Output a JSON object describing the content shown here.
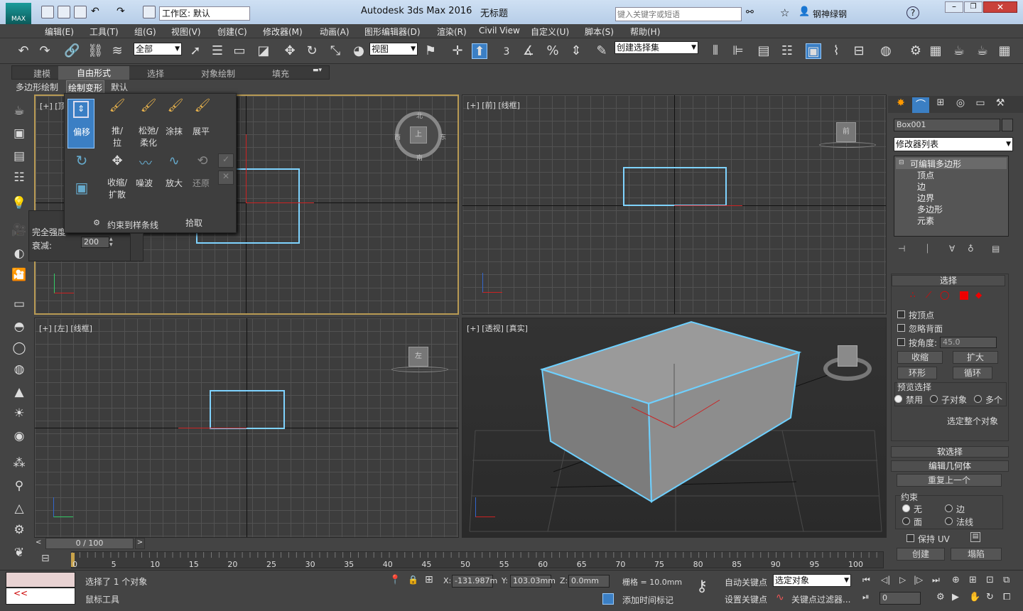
{
  "titlebar": {
    "app_title": "Autodesk 3ds Max 2016",
    "doc_title": "无标题",
    "workspace": "工作区: 默认",
    "search_placeholder": "键入关键字或短语",
    "user": "钢神绿钢"
  },
  "menu": [
    "编辑(E)",
    "工具(T)",
    "组(G)",
    "视图(V)",
    "创建(C)",
    "修改器(M)",
    "动画(A)",
    "图形编辑器(D)",
    "渲染(R)",
    "Civil View",
    "自定义(U)",
    "脚本(S)",
    "帮助(H)"
  ],
  "toolbar": {
    "filter": "全部",
    "ref_coord": "视图",
    "named_sel": "创建选择集",
    "spinner_label": "3"
  },
  "ribbon": {
    "tabs": [
      "建模",
      "自由形式",
      "选择",
      "对象绘制",
      "填充"
    ],
    "subtabs": [
      "多边形绘制",
      "绘制变形",
      "默认"
    ]
  },
  "popup": {
    "move": "偏移",
    "push_pull": "推/拉",
    "relax": "松弛/柔化",
    "smudge": "涂抹",
    "flatten": "展平",
    "shrink": "收缩/扩散",
    "noise": "噪波",
    "exaggerate": "放大",
    "revert": "还原",
    "constrain": "约束到样条线",
    "pick": "拾取",
    "full_strength": "完全强度",
    "falloff_label": "衰减:",
    "falloff_value": "200"
  },
  "viewports": {
    "top": "[+] [顶",
    "front": "[+] [前] [线框]",
    "left": "[+] [左] [线框]",
    "persp": "[+] [透视] [真实]",
    "cube_n": "北",
    "cube_s": "南",
    "cube_e": "东",
    "cube_w": "西",
    "cube_top": "上",
    "cube_front": "前",
    "cube_left": "左"
  },
  "panel": {
    "object_name": "Box001",
    "modifier_list": "修改器列表",
    "stack": [
      "可编辑多边形",
      "顶点",
      "边",
      "边界",
      "多边形",
      "元素"
    ],
    "selection": "选择",
    "by_vertex": "按顶点",
    "ignore_back": "忽略背面",
    "by_angle": "按角度:",
    "angle_value": "45.0",
    "shrink": "收缩",
    "grow": "扩大",
    "ring": "环形",
    "loop": "循环",
    "preview": "预览选择",
    "disable": "禁用",
    "subobj": "子对象",
    "multi": "多个",
    "select_whole": "选定整个对象",
    "soft_sel": "软选择",
    "edit_geom": "编辑几何体",
    "repeat_last": "重复上一个",
    "constraints": "约束",
    "c_none": "无",
    "c_edge": "边",
    "c_face": "面",
    "c_normal": "法线",
    "preserve_uv": "保持 UV",
    "create": "创建",
    "collapse": "塌陷"
  },
  "timeline": {
    "frame": "0 / 100",
    "ticks": [
      "0",
      "5",
      "10",
      "15",
      "20",
      "25",
      "30",
      "35",
      "40",
      "45",
      "50",
      "55",
      "60",
      "65",
      "70",
      "75",
      "80",
      "85",
      "90",
      "95",
      "100"
    ]
  },
  "status": {
    "message": "选择了 1 个对象",
    "prompt": "鼠标工具",
    "x": "-131.987m",
    "y": "103.03mm",
    "z": "0.0mm",
    "grid": "栅格 = 10.0mm",
    "auto_key": "自动关键点",
    "selected": "选定对象",
    "set_key": "设置关键点",
    "key_filters": "关键点过滤器...",
    "add_time_tag": "添加时间标记",
    "frame_field": "0",
    "x_label": "X:",
    "y_label": "Y:",
    "z_label": "Z:"
  },
  "colors": {
    "accent": "#7fd3ff",
    "active_btn": "#3b7fc4",
    "selection_red": "#e00000"
  }
}
